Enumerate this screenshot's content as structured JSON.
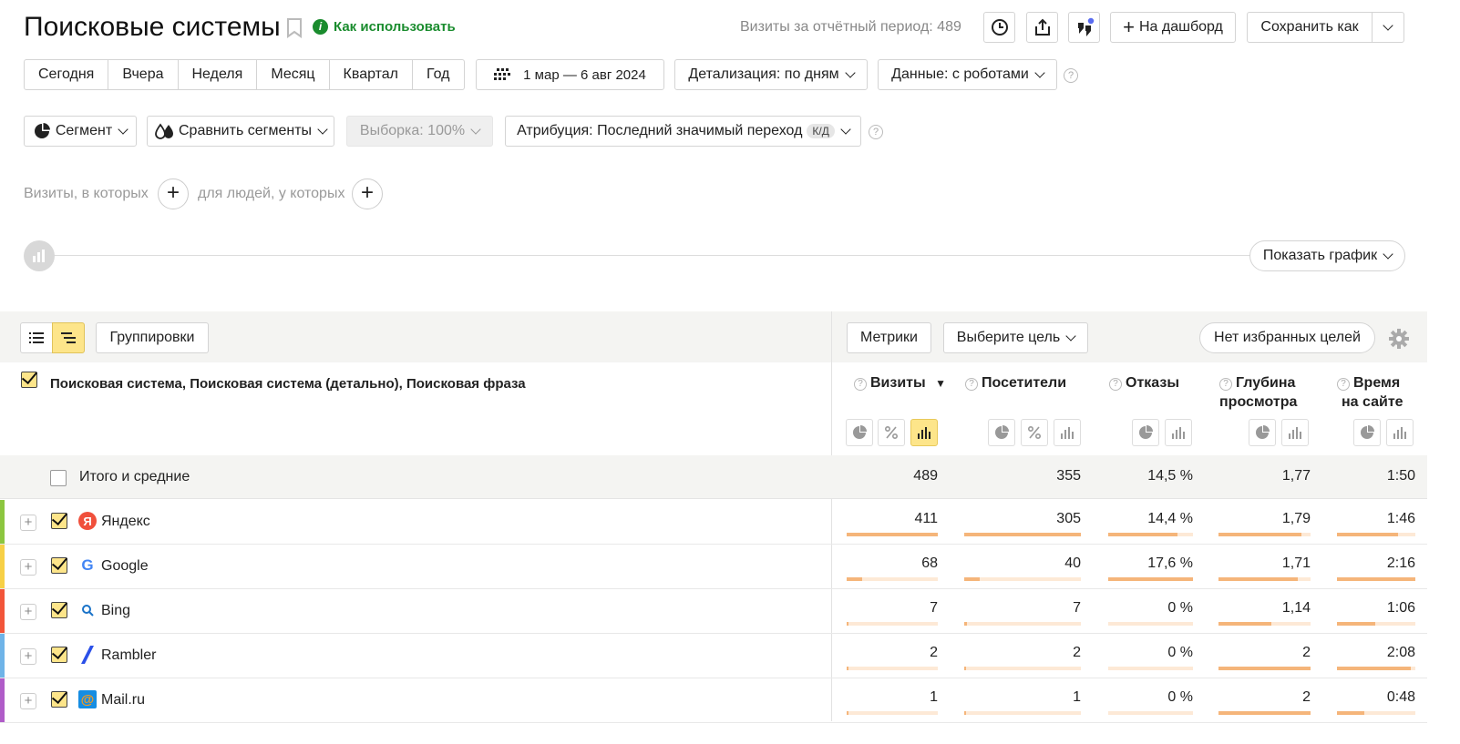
{
  "header": {
    "title": "Поисковые системы",
    "how_to_use": "Как использовать",
    "visits_period": "Визиты за отчётный период: 489",
    "to_dashboard": "На дашборд",
    "save_as": "Сохранить как"
  },
  "periods": [
    "Сегодня",
    "Вчера",
    "Неделя",
    "Месяц",
    "Квартал",
    "Год"
  ],
  "filters": {
    "date_range": "1 мар — 6 авг 2024",
    "detail": "Детализация: по дням",
    "data": "Данные: с роботами",
    "segment": "Сегмент",
    "compare": "Сравнить сегменты",
    "sample": "Выборка: 100%",
    "attribution": "Атрибуция: Последний значимый переход",
    "attribution_badge": "К/Д",
    "visits_where": "Визиты, в которых",
    "people_where": "для людей, у которых",
    "show_chart": "Показать график"
  },
  "toolbar": {
    "groupings": "Группировки",
    "metrics": "Метрики",
    "choose_goal": "Выберите цель",
    "no_favorites": "Нет избранных целей"
  },
  "table": {
    "dimension_header": "Поисковая система, Поисковая система (детально), Поисковая фраза",
    "col_visits": "Визиты",
    "sort_mark": "▼",
    "col_visitors": "Посетители",
    "col_bounce": "Отказы",
    "col_depth_1": "Глубина",
    "col_depth_2": "просмотра",
    "col_time_1": "Время",
    "col_time_2": "на сайте",
    "totals": {
      "label": "Итого и средние",
      "visits": "489",
      "visitors": "355",
      "bounce": "14,5 %",
      "depth": "1,77",
      "time": "1:50"
    },
    "rows": [
      {
        "name": "Яндекс",
        "logo": "Я",
        "stripe": "#8cc63f",
        "visits": "411",
        "visitors": "305",
        "bounce": "14,4 %",
        "depth": "1,79",
        "time": "1:46",
        "p_visits": 1.0,
        "p_visitors": 1.0,
        "p_bounce": 0.82,
        "p_depth": 0.9,
        "p_time": 0.78
      },
      {
        "name": "Google",
        "logo": "G",
        "stripe": "#f7d046",
        "visits": "68",
        "visitors": "40",
        "bounce": "17,6 %",
        "depth": "1,71",
        "time": "2:16",
        "p_visits": 0.17,
        "p_visitors": 0.13,
        "p_bounce": 1.0,
        "p_depth": 0.86,
        "p_time": 1.0
      },
      {
        "name": "Bing",
        "logo": "search-icon",
        "stripe": "#f2553a",
        "visits": "7",
        "visitors": "7",
        "bounce": "0 %",
        "depth": "1,14",
        "time": "1:06",
        "p_visits": 0.02,
        "p_visitors": 0.02,
        "p_bounce": 0.0,
        "p_depth": 0.57,
        "p_time": 0.49
      },
      {
        "name": "Rambler",
        "logo": "rambler-icon",
        "stripe": "#6fb4e8",
        "visits": "2",
        "visitors": "2",
        "bounce": "0 %",
        "depth": "2",
        "time": "2:08",
        "p_visits": 0.005,
        "p_visitors": 0.005,
        "p_bounce": 0.0,
        "p_depth": 1.0,
        "p_time": 0.94
      },
      {
        "name": "Mail.ru",
        "logo": "@",
        "stripe": "#b05cc8",
        "visits": "1",
        "visitors": "1",
        "bounce": "0 %",
        "depth": "2",
        "time": "0:48",
        "p_visits": 0.003,
        "p_visitors": 0.003,
        "p_bounce": 0.0,
        "p_depth": 1.0,
        "p_time": 0.35
      }
    ]
  },
  "colors": {
    "accent_yellow": "#fde58a",
    "bar_fill": "#f5b57a",
    "bar_track": "#fde9d6",
    "how_to_green": "#1a8c2e"
  }
}
